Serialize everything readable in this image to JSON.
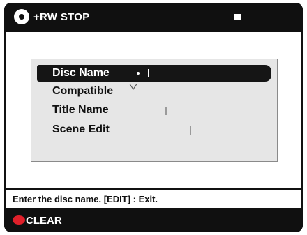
{
  "header": {
    "disc_type": "+RW",
    "status": "STOP",
    "disc_icon": "disc-icon",
    "stop_icon": "stop-icon"
  },
  "menu": {
    "items": [
      {
        "label": "Disc Name",
        "selected": true
      },
      {
        "label": "Compatible",
        "selected": false
      },
      {
        "label": "Title Name",
        "selected": false
      },
      {
        "label": "Scene Edit",
        "selected": false
      }
    ]
  },
  "status_text": "Enter the disc name. [EDIT] : Exit.",
  "footer": {
    "clear_label": "CLEAR",
    "button_color": "#e0202a"
  },
  "colors": {
    "bar": "#101010",
    "panel": "#e6e6e6",
    "highlight": "#151515"
  }
}
